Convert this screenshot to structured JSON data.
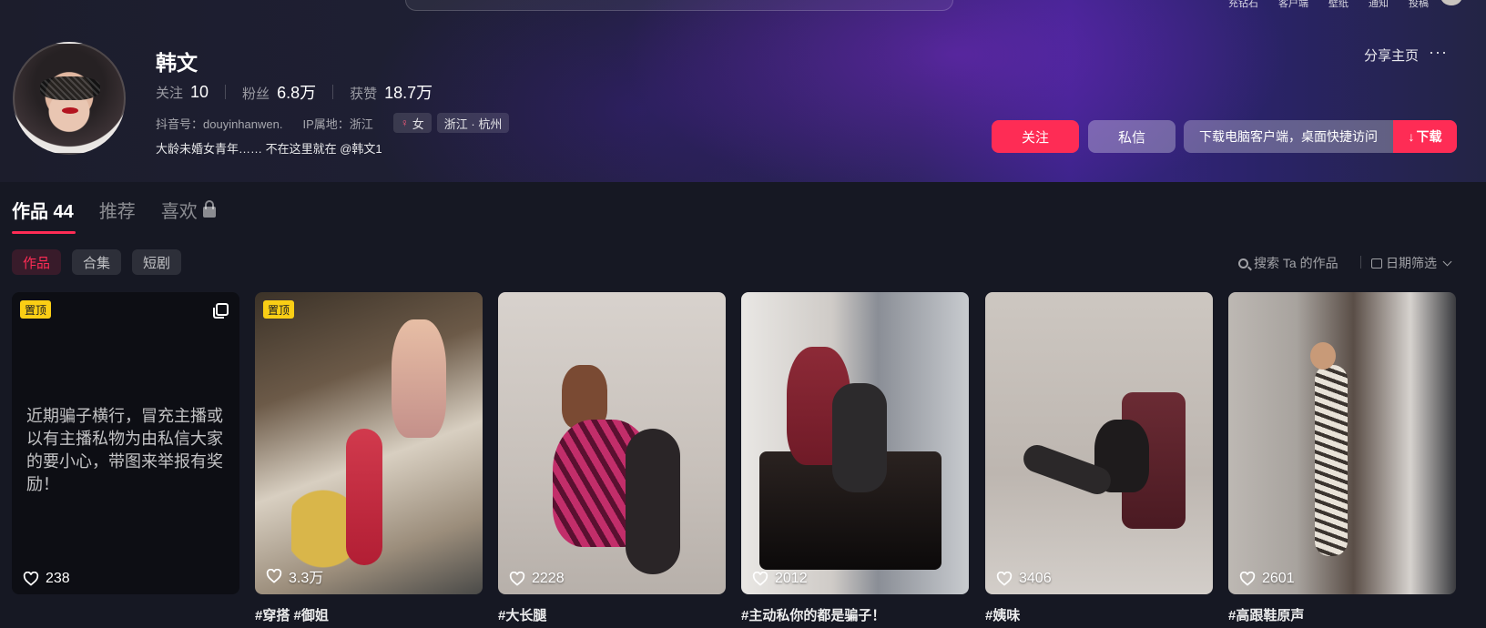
{
  "topnav": [
    "充钻石",
    "客户端",
    "壁纸",
    "通知",
    "投稿"
  ],
  "profile": {
    "name": "韩文",
    "stats": [
      {
        "label": "关注",
        "value": "10"
      },
      {
        "label": "粉丝",
        "value": "6.8万"
      },
      {
        "label": "获赞",
        "value": "18.7万"
      }
    ],
    "douyin_id": "抖音号：douyinhanwen.",
    "ip": "IP属地：浙江",
    "gender_tag": "女",
    "location_tag": "浙江 · 杭州",
    "bio": "大龄未婚女青年…… 不在这里就在 @韩文1"
  },
  "actions": {
    "share": "分享主页",
    "more": "···",
    "follow": "关注",
    "message": "私信",
    "download_prompt": "下载电脑客户端，桌面快捷访问",
    "download": "下载"
  },
  "tabs": [
    {
      "label": "作品 44",
      "active": true
    },
    {
      "label": "推荐",
      "active": false
    },
    {
      "label": "喜欢",
      "active": false,
      "locked": true
    }
  ],
  "subtabs": [
    {
      "label": "作品",
      "active": true
    },
    {
      "label": "合集",
      "active": false
    },
    {
      "label": "短剧",
      "active": false
    }
  ],
  "search_works": "搜索 Ta 的作品",
  "date_filter": "日期筛选",
  "colors": {
    "accent": "#fe2c55",
    "pin": "#face15",
    "background": "#161823"
  },
  "videos": [
    {
      "pinned": true,
      "pin_label": "置顶",
      "multi": true,
      "text": "近期骗子横行，冒充主播或以有主播私物为由私信大家的要小心，带图来举报有奖励！",
      "likes": "238",
      "caption": ""
    },
    {
      "pinned": true,
      "pin_label": "置顶",
      "likes": "3.3万",
      "caption": "#穿搭 #御姐"
    },
    {
      "likes": "2228",
      "caption": "#大长腿"
    },
    {
      "likes": "2012",
      "caption": "#主动私你的都是骗子！"
    },
    {
      "likes": "3406",
      "caption": "#姨味"
    },
    {
      "likes": "2601",
      "caption": "#高跟鞋原声"
    }
  ]
}
